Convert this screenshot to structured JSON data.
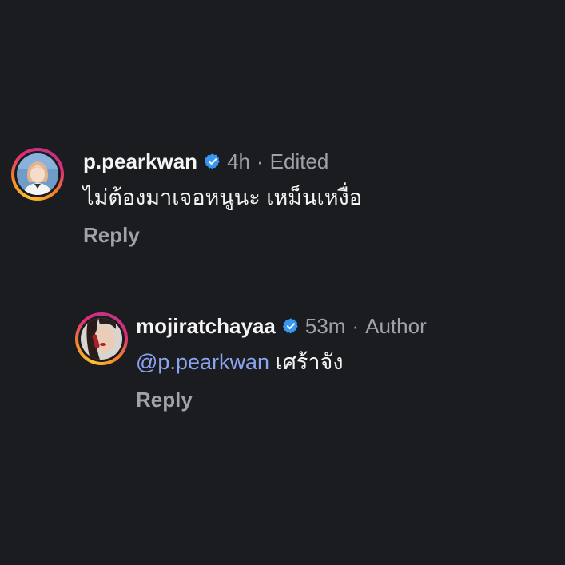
{
  "comments": [
    {
      "username": "p.pearkwan",
      "time": "4h",
      "separator": "·",
      "tag": "Edited",
      "text": "ไม่ต้องมาเจอหนูนะ เหม็นเหงื่อ",
      "reply_label": "Reply",
      "avatar_icon": "profile-photo"
    },
    {
      "username": "mojiratchayaa",
      "time": "53m",
      "separator": "·",
      "tag": "Author",
      "mention": "@p.pearkwan",
      "text": "เศร้าจัง",
      "reply_label": "Reply",
      "avatar_icon": "profile-photo"
    }
  ],
  "colors": {
    "background": "#1b1c1f",
    "verified": "#3897f0",
    "mention": "#8aa4f2",
    "muted": "#a0a2a8"
  }
}
